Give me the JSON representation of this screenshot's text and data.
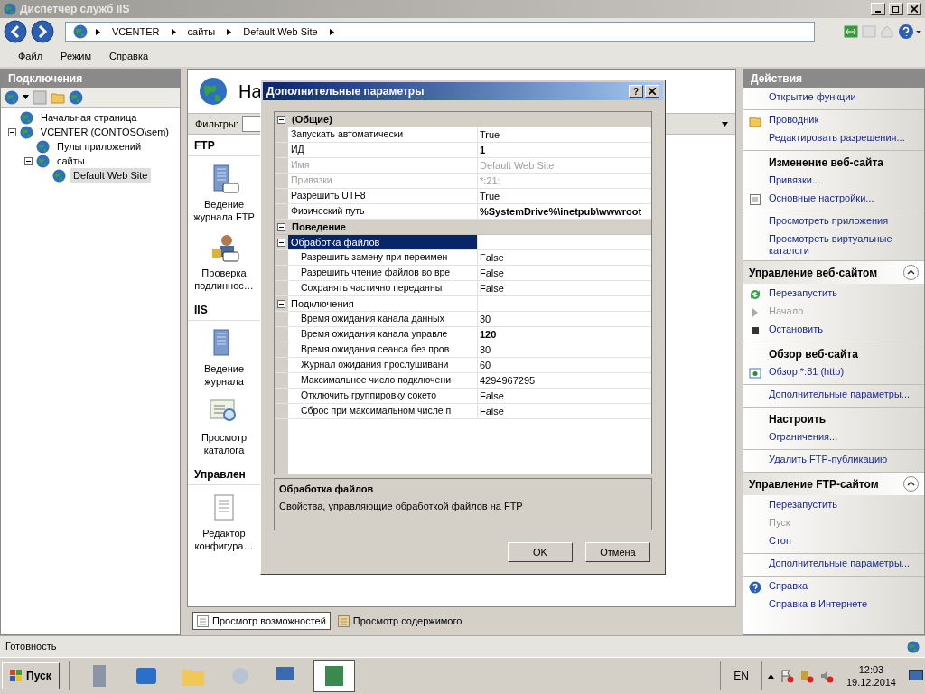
{
  "window": {
    "title": "Диспетчер служб IIS"
  },
  "address": {
    "crumbs": [
      "VCENTER",
      "сайты",
      "Default Web Site"
    ]
  },
  "menu": [
    "Файл",
    "Режим",
    "Справка"
  ],
  "connections": {
    "title": "Подключения",
    "tree": [
      {
        "label": "Начальная страница",
        "selected": false
      },
      {
        "label": "VCENTER (CONTOSO\\sem)",
        "selected": false,
        "expanded": true,
        "children": [
          {
            "label": "Пулы приложений",
            "selected": false
          },
          {
            "label": "сайты",
            "selected": false,
            "expanded": true,
            "children": [
              {
                "label": "Default Web Site",
                "selected": true
              }
            ]
          }
        ]
      }
    ]
  },
  "center": {
    "title": "На",
    "filter_label": "Фильтры:",
    "groups": [
      {
        "title": "FTP",
        "features": [
          "Ведение журнала FTP",
          "Проверка подлиннос…"
        ]
      },
      {
        "title": "IIS",
        "features": [
          "Ведение журнала",
          "Просмотр каталога"
        ]
      },
      {
        "title": "Управлен",
        "features": [
          "Редактор конфигура…"
        ]
      }
    ],
    "tabs": [
      {
        "label": "Просмотр возможностей",
        "selected": true
      },
      {
        "label": "Просмотр содержимого",
        "selected": false
      }
    ]
  },
  "dialog": {
    "title": "Дополнительные параметры",
    "help_button": "?",
    "rows": [
      {
        "kind": "category",
        "label": "(Общие)",
        "expanded": true,
        "children": [
          {
            "kind": "property",
            "label": "Запускать автоматически",
            "value": "True",
            "disabled": false,
            "value_bold": false
          },
          {
            "kind": "property",
            "label": "ИД",
            "value": "1",
            "disabled": false,
            "value_bold": true
          },
          {
            "kind": "property",
            "label": "Имя",
            "value": "Default Web Site",
            "disabled": true,
            "value_bold": false
          },
          {
            "kind": "property",
            "label": "Привязки",
            "value": "*:21:",
            "disabled": true,
            "value_bold": false
          },
          {
            "kind": "property",
            "label": "Разрешить UTF8",
            "value": "True",
            "disabled": false,
            "value_bold": false
          },
          {
            "kind": "property",
            "label": "Физический путь",
            "value": "%SystemDrive%\\inetpub\\wwwroot",
            "disabled": false,
            "value_bold": true
          }
        ]
      },
      {
        "kind": "category",
        "label": "Поведение",
        "expanded": true,
        "children": [
          {
            "kind": "group",
            "label": "Обработка файлов",
            "expanded": true,
            "selected": true,
            "children": [
              {
                "kind": "property",
                "label": "Разрешить замену при переимен",
                "value": "False",
                "disabled": false,
                "value_bold": false
              },
              {
                "kind": "property",
                "label": "Разрешить чтение файлов во вре",
                "value": "False",
                "disabled": false,
                "value_bold": false
              },
              {
                "kind": "property",
                "label": "Сохранять частично переданны",
                "value": "False",
                "disabled": false,
                "value_bold": false
              }
            ]
          },
          {
            "kind": "group",
            "label": "Подключения",
            "expanded": true,
            "selected": false,
            "children": [
              {
                "kind": "property",
                "label": "Время ожидания канала данных",
                "value": "30",
                "disabled": false,
                "value_bold": false
              },
              {
                "kind": "property",
                "label": "Время ожидания канала управле",
                "value": "120",
                "disabled": false,
                "value_bold": true
              },
              {
                "kind": "property",
                "label": "Время ожидания сеанса без пров",
                "value": "30",
                "disabled": false,
                "value_bold": false
              },
              {
                "kind": "property",
                "label": "Журнал ожидания прослушивани",
                "value": "60",
                "disabled": false,
                "value_bold": false
              },
              {
                "kind": "property",
                "label": "Максимальное число подключени",
                "value": "4294967295",
                "disabled": false,
                "value_bold": false
              },
              {
                "kind": "property",
                "label": "Отключить группировку сокето",
                "value": "False",
                "disabled": false,
                "value_bold": false
              },
              {
                "kind": "property",
                "label": "Сброс при максимальном числе п",
                "value": "False",
                "disabled": false,
                "value_bold": false
              }
            ]
          }
        ]
      }
    ],
    "description": {
      "title": "Обработка файлов",
      "text": "Свойства, управляющие обработкой файлов на FTP"
    },
    "buttons": [
      "OK",
      "Отмена"
    ]
  },
  "actions": {
    "title": "Действия",
    "sections": [
      {
        "groups": [
          [
            {
              "kind": "link",
              "label": "Открытие функции",
              "disabled": false
            }
          ],
          [
            {
              "kind": "link",
              "label": "Проводник",
              "disabled": false
            },
            {
              "kind": "link",
              "label": "Редактировать разрешения...",
              "disabled": false
            }
          ],
          [
            {
              "kind": "heading",
              "label": "Изменение веб-сайта"
            },
            {
              "kind": "link",
              "label": "Привязки...",
              "disabled": false
            },
            {
              "kind": "link",
              "label": "Основные настройки...",
              "disabled": false
            }
          ],
          [
            {
              "kind": "link",
              "label": "Просмотреть приложения",
              "disabled": false
            },
            {
              "kind": "link",
              "label": "Просмотреть виртуальные каталоги",
              "disabled": false
            }
          ]
        ]
      },
      {
        "title": "Управление веб-сайтом",
        "groups": [
          [
            {
              "kind": "link",
              "label": "Перезапустить",
              "disabled": false
            },
            {
              "kind": "link",
              "label": "Начало",
              "disabled": true
            },
            {
              "kind": "link",
              "label": "Остановить",
              "disabled": false
            }
          ],
          [
            {
              "kind": "heading",
              "label": "Обзор веб-сайта"
            },
            {
              "kind": "link",
              "label": "Обзор *:81 (http)",
              "disabled": false
            }
          ],
          [
            {
              "kind": "link",
              "label": "Дополнительные параметры...",
              "disabled": false
            }
          ],
          [
            {
              "kind": "heading",
              "label": "Настроить"
            },
            {
              "kind": "link",
              "label": "Ограничения...",
              "disabled": false
            }
          ],
          [
            {
              "kind": "link",
              "label": "Удалить FTP-публикацию",
              "disabled": false
            }
          ]
        ]
      },
      {
        "title": "Управление FTP-сайтом",
        "groups": [
          [
            {
              "kind": "link",
              "label": "Перезапустить",
              "disabled": false
            },
            {
              "kind": "link",
              "label": "Пуск",
              "disabled": true
            },
            {
              "kind": "link",
              "label": "Стоп",
              "disabled": false
            }
          ],
          [
            {
              "kind": "link",
              "label": "Дополнительные параметры...",
              "disabled": false
            }
          ],
          [
            {
              "kind": "link",
              "label": "Справка",
              "disabled": false
            },
            {
              "kind": "link",
              "label": "Справка в Интернете",
              "disabled": false
            }
          ]
        ]
      }
    ]
  },
  "status_bar": {
    "text": "Готовность"
  },
  "taskbar": {
    "start": "Пуск",
    "apps": [
      {
        "selected": false
      },
      {
        "selected": false
      },
      {
        "selected": false
      },
      {
        "selected": false
      },
      {
        "selected": false
      },
      {
        "selected": true
      }
    ],
    "language": "EN",
    "time": "12:03",
    "date": "19.12.2014"
  }
}
